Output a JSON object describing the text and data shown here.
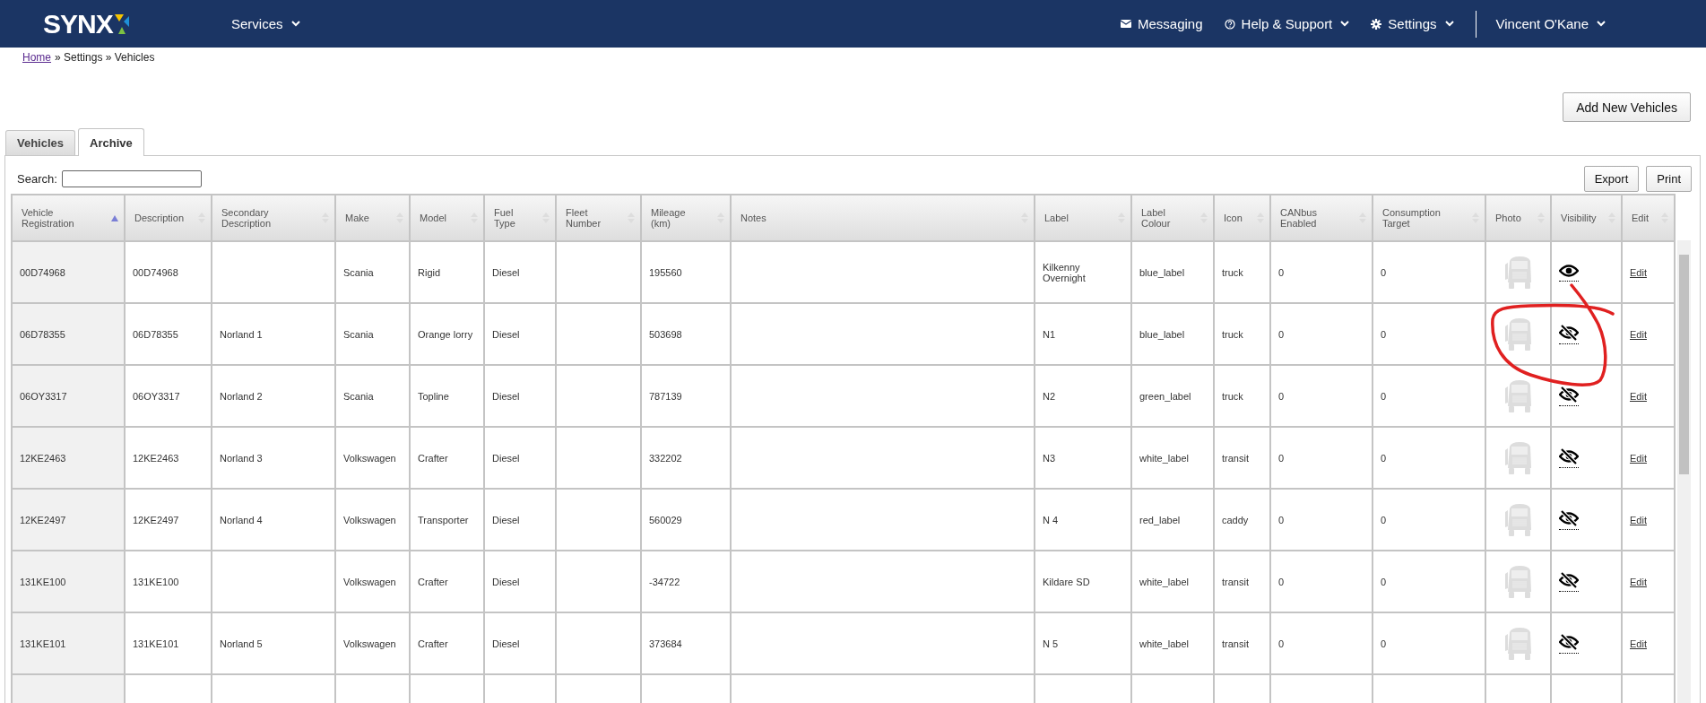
{
  "topbar": {
    "logo": "SYNX",
    "nav": [
      {
        "label": "Services",
        "kind": "dropdown"
      }
    ],
    "right_nav": [
      {
        "label": "Messaging",
        "kind": "messaging"
      },
      {
        "label": "Help & Support",
        "kind": "help"
      },
      {
        "label": "Settings",
        "kind": "settings"
      }
    ],
    "user": "Vincent O'Kane"
  },
  "breadcrumb": {
    "link": "Home",
    "rest": "» Settings » Vehicles"
  },
  "add_button": "Add New Vehicles",
  "tabs": [
    {
      "label": "Vehicles",
      "selected": false
    },
    {
      "label": "Archive",
      "selected": true
    }
  ],
  "search": {
    "label": "Search:"
  },
  "actions": [
    "Export",
    "Print"
  ],
  "table": {
    "columns": [
      {
        "label": "Vehicle Registration",
        "sorted": true
      },
      {
        "label": "Description",
        "sorted": false
      },
      {
        "label": "Secondary Description",
        "sorted": false
      },
      {
        "label": "Make",
        "sorted": false
      },
      {
        "label": "Model",
        "sorted": false
      },
      {
        "label": "Fuel Type",
        "sorted": false
      },
      {
        "label": "Fleet Number",
        "sorted": false
      },
      {
        "label": "Mileage (km)",
        "sorted": false
      },
      {
        "label": "Notes",
        "sorted": false
      },
      {
        "label": "Label",
        "sorted": false
      },
      {
        "label": "Label Colour",
        "sorted": false
      },
      {
        "label": "Icon",
        "sorted": false
      },
      {
        "label": "CANbus Enabled",
        "sorted": false
      },
      {
        "label": "Consumption Target",
        "sorted": false
      },
      {
        "label": "Photo",
        "sorted": false
      },
      {
        "label": "Visibility",
        "sorted": false
      },
      {
        "label": "Edit",
        "sorted": false
      }
    ],
    "rows": [
      {
        "registration": "00D74968",
        "description": "00D74968",
        "make": "Scania",
        "model": "Rigid",
        "fuel_type": "Diesel",
        "mileage": "195560",
        "label": "Kilkenny Overnight",
        "label_colour": "blue_label",
        "icon": "truck",
        "canbus_enabled": "0",
        "consumption_target": "0",
        "visible": true,
        "edit": "Edit"
      },
      {
        "registration": "06D78355",
        "description": "06D78355",
        "secondary_description": "Norland 1",
        "make": "Scania",
        "model": "Orange lorry",
        "fuel_type": "Diesel",
        "mileage": "503698",
        "label": "N1",
        "label_colour": "blue_label",
        "icon": "truck",
        "canbus_enabled": "0",
        "consumption_target": "0",
        "visible": false,
        "edit": "Edit"
      },
      {
        "registration": "06OY3317",
        "description": "06OY3317",
        "secondary_description": "Norland 2",
        "make": "Scania",
        "model": "Topline",
        "fuel_type": "Diesel",
        "mileage": "787139",
        "label": "N2",
        "label_colour": "green_label",
        "icon": "truck",
        "canbus_enabled": "0",
        "consumption_target": "0",
        "visible": false,
        "edit": "Edit"
      },
      {
        "registration": "12KE2463",
        "description": "12KE2463",
        "secondary_description": "Norland 3",
        "make": "Volkswagen",
        "model": "Crafter",
        "fuel_type": "Diesel",
        "mileage": "332202",
        "label": "N3",
        "label_colour": "white_label",
        "icon": "transit",
        "canbus_enabled": "0",
        "consumption_target": "0",
        "visible": false,
        "edit": "Edit"
      },
      {
        "registration": "12KE2497",
        "description": "12KE2497",
        "secondary_description": "Norland 4",
        "make": "Volkswagen",
        "model": "Transporter",
        "fuel_type": "Diesel",
        "mileage": "560029",
        "label": "N 4",
        "label_colour": "red_label",
        "icon": "caddy",
        "canbus_enabled": "0",
        "consumption_target": "0",
        "visible": false,
        "edit": "Edit"
      },
      {
        "registration": "131KE100",
        "description": "131KE100",
        "make": "Volkswagen",
        "model": "Crafter",
        "fuel_type": "Diesel",
        "mileage": "-34722",
        "label": "Kildare SD",
        "label_colour": "white_label",
        "icon": "transit",
        "canbus_enabled": "0",
        "consumption_target": "0",
        "visible": false,
        "edit": "Edit"
      },
      {
        "registration": "131KE101",
        "description": "131KE101",
        "secondary_description": "Norland 5",
        "make": "Volkswagen",
        "model": "Crafter",
        "fuel_type": "Diesel",
        "mileage": "373684",
        "label": "N 5",
        "label_colour": "white_label",
        "icon": "transit",
        "canbus_enabled": "0",
        "consumption_target": "0",
        "visible": false,
        "edit": "Edit"
      }
    ]
  }
}
